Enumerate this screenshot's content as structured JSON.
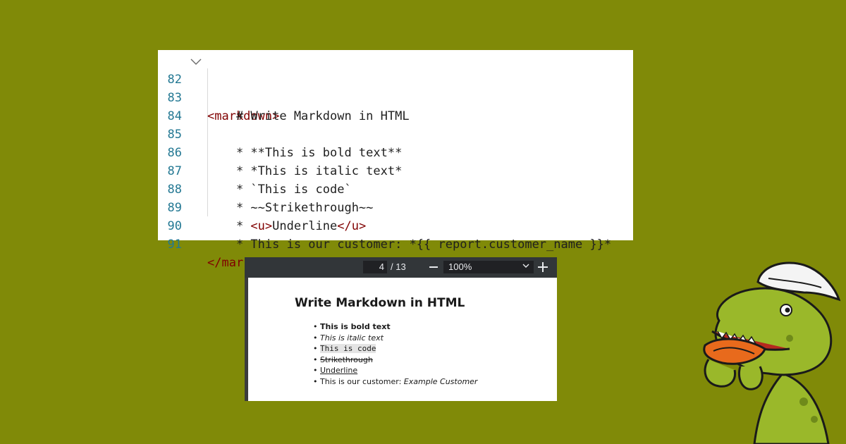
{
  "editor": {
    "lines": [
      {
        "num": "82",
        "text": "<markdown>",
        "type": "open-tag"
      },
      {
        "num": "83",
        "text": "    # Write Markdown in HTML"
      },
      {
        "num": "84",
        "text": ""
      },
      {
        "num": "85",
        "text": "    * **This is bold text**"
      },
      {
        "num": "86",
        "text": "    * *This is italic text*"
      },
      {
        "num": "87",
        "text": "    * `This is code`"
      },
      {
        "num": "88",
        "text": "    * ~~Strikethrough~~"
      },
      {
        "num": "89",
        "prefix": "    * ",
        "tag_open": "<u>",
        "middle": "Underline",
        "tag_close": "</u>"
      },
      {
        "num": "90",
        "text": "    * This is our customer: *{{ report.customer_name }}*"
      },
      {
        "num": "91",
        "text": "</markdown>",
        "type": "close-tag"
      }
    ],
    "fold_icon": "chevron-down-icon"
  },
  "viewer": {
    "page_current": "4",
    "page_total": "/ 13",
    "zoom": "100%",
    "zoom_out_icon": "minus-icon",
    "zoom_in_icon": "plus-icon",
    "document": {
      "title": "Write Markdown in HTML",
      "items": {
        "bold": "This is bold text",
        "italic": "This is italic text",
        "code": "This is code",
        "strike": "Strikethrough",
        "underline": "Underline",
        "customer_prefix": "This is our customer: ",
        "customer_name": "Example Customer"
      }
    }
  },
  "mascot": "dinosaur-mascot-icon",
  "colors": {
    "background": "#808a08",
    "tag": "#800000",
    "line_number": "#237893",
    "toolbar": "#323639"
  }
}
